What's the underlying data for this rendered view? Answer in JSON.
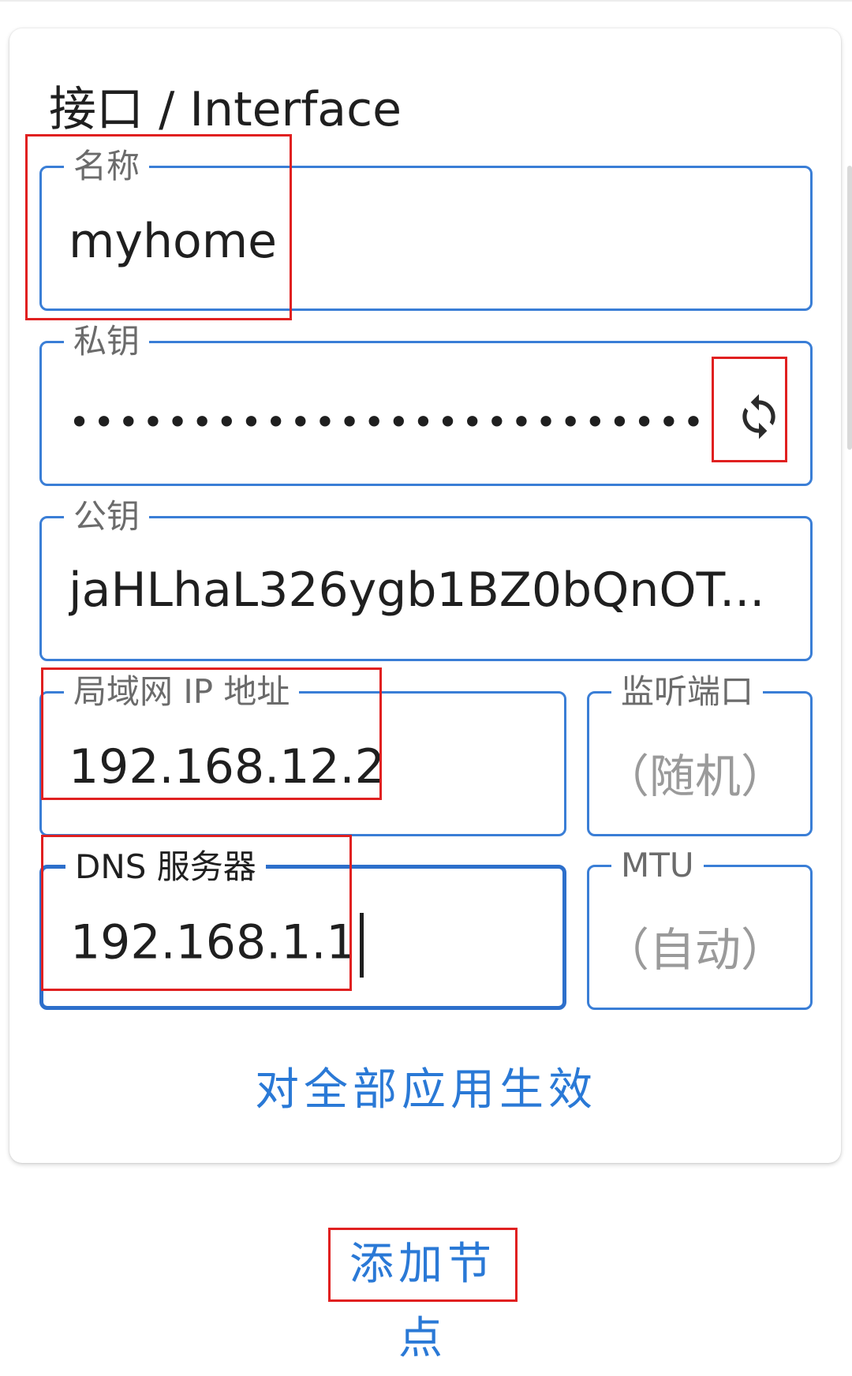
{
  "interface": {
    "title": "接口 / Interface",
    "name_field": {
      "label": "名称",
      "value": "myhome"
    },
    "private_key_field": {
      "label": "私钥",
      "value": "••••••••••••••••••••••••••••••••••••••••",
      "refresh_icon": "refresh-icon"
    },
    "public_key_field": {
      "label": "公钥",
      "value": "jaHLhaL326ygb1BZ0bQnOT..."
    },
    "address_field": {
      "label": "局域网 IP 地址",
      "value": "192.168.12.2"
    },
    "listen_port_field": {
      "label": "监听端口",
      "hint": "（随机）"
    },
    "dns_field": {
      "label": "DNS 服务器",
      "value": "192.168.1.1"
    },
    "mtu_field": {
      "label": "MTU",
      "hint": "（自动）"
    },
    "apply_all_label": "对全部应用生效"
  },
  "add_peer_label": "添加节点",
  "colors": {
    "accent": "#2a79d6",
    "border": "#3a7ed6",
    "highlight": "#e02020"
  }
}
